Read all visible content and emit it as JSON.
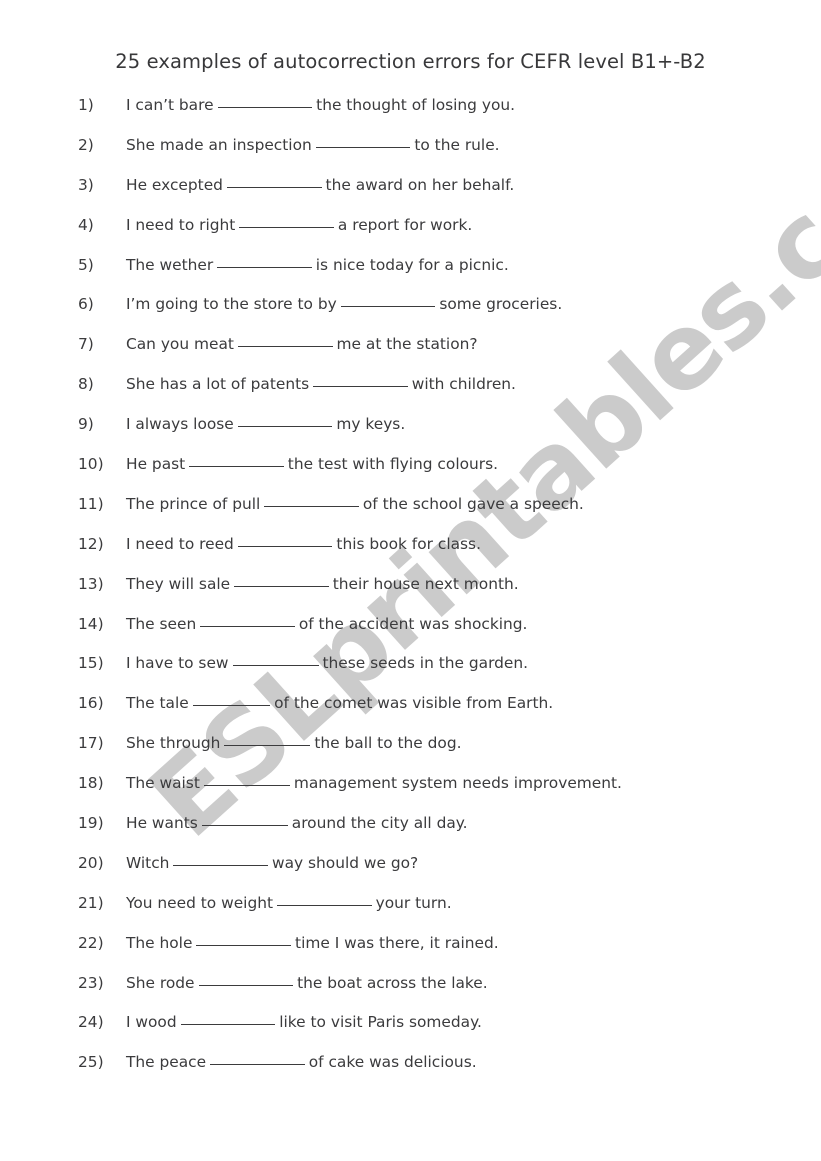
{
  "document": {
    "title": "25 examples of autocorrection errors for CEFR level B1+-B2",
    "page_background": "#ffffff",
    "text_color": "#3b3b3d"
  },
  "watermark": {
    "text": "ESLprintables.com",
    "color": "#cbcbcb",
    "rotation_degrees": -42
  },
  "items": [
    {
      "number": "1)",
      "before": "I can’t bare",
      "blank": "___________",
      "after": "the thought of losing you."
    },
    {
      "number": "2)",
      "before": "She made an inspection",
      "blank": "___________",
      "after": "to the rule."
    },
    {
      "number": "3)",
      "before": "He excepted",
      "blank": "___________",
      "after": "the award on her behalf."
    },
    {
      "number": "4)",
      "before": "I need to right",
      "blank": "___________",
      "after": "a report for work."
    },
    {
      "number": "5)",
      "before": "The wether",
      "blank": "___________",
      "after": "is nice today for a picnic."
    },
    {
      "number": "6)",
      "before": "I’m going to the store to by",
      "blank": "___________",
      "after": "some groceries."
    },
    {
      "number": "7)",
      "before": "Can you meat",
      "blank": "___________",
      "after": "me at the station?"
    },
    {
      "number": "8)",
      "before": "She has a lot of patents",
      "blank": "___________",
      "after": "with children."
    },
    {
      "number": "9)",
      "before": "I always loose",
      "blank": "___________",
      "after": "my keys."
    },
    {
      "number": "10)",
      "before": "He past",
      "blank": "___________",
      "after": "the test with flying colours."
    },
    {
      "number": "11)",
      "before": "The prince of pull",
      "blank": "___________",
      "after": "of the school gave a speech."
    },
    {
      "number": "12)",
      "before": "I need to reed",
      "blank": "___________",
      "after": "this book for class."
    },
    {
      "number": "13)",
      "before": "They will sale",
      "blank": "___________",
      "after": "their house next month."
    },
    {
      "number": "14)",
      "before": "The seen",
      "blank": "___________",
      "after": "of the accident was shocking."
    },
    {
      "number": "15)",
      "before": "I have to sew",
      "blank": "__________",
      "after": "these seeds in the garden."
    },
    {
      "number": "16)",
      "before": "The tale",
      "blank": "_________",
      "after": "of the comet was visible from Earth."
    },
    {
      "number": "17)",
      "before": "She through",
      "blank": "__________",
      "after": "the ball to the dog."
    },
    {
      "number": "18)",
      "before": "The waist",
      "blank": "__________",
      "after": "management system needs improvement."
    },
    {
      "number": "19)",
      "before": "He wants",
      "blank": "__________",
      "after": "around the city all day."
    },
    {
      "number": "20)",
      "before": "Witch",
      "blank": "___________",
      "after": "way should we go?"
    },
    {
      "number": "21)",
      "before": "You need to weight",
      "blank": "___________",
      "after": "your turn."
    },
    {
      "number": "22)",
      "before": "The hole",
      "blank": "___________",
      "after": "time I was there, it rained."
    },
    {
      "number": "23)",
      "before": "She rode",
      "blank": "___________",
      "after": "the boat across the lake."
    },
    {
      "number": "24)",
      "before": "I wood",
      "blank": "___________",
      "after": "like to visit Paris someday."
    },
    {
      "number": "25)",
      "before": "The peace",
      "blank": "___________",
      "after": "of cake was delicious."
    }
  ]
}
